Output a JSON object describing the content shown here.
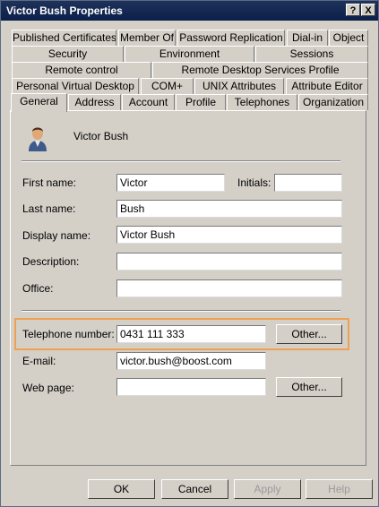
{
  "window": {
    "title": "Victor Bush Properties"
  },
  "titlebar_buttons": {
    "help": "?",
    "close": "X"
  },
  "tabs": {
    "row1": [
      "Published Certificates",
      "Member Of",
      "Password Replication",
      "Dial-in",
      "Object"
    ],
    "row2": [
      "Security",
      "Environment",
      "Sessions"
    ],
    "row3": [
      "Remote control",
      "Remote Desktop Services Profile"
    ],
    "row4": [
      "Personal Virtual Desktop",
      "COM+",
      "UNIX Attributes",
      "Attribute Editor"
    ],
    "row5": [
      "General",
      "Address",
      "Account",
      "Profile",
      "Telephones",
      "Organization"
    ],
    "active": "General"
  },
  "general": {
    "display": "Victor Bush",
    "first_name_label": "First name:",
    "first_name": "Victor",
    "initials_label": "Initials:",
    "initials": "",
    "last_name_label": "Last name:",
    "last_name": "Bush",
    "display_name_label": "Display name:",
    "display_name": "Victor Bush",
    "description_label": "Description:",
    "description": "",
    "office_label": "Office:",
    "office": "",
    "telephone_label": "Telephone number:",
    "telephone": "0431 111 333",
    "telephone_other": "Other...",
    "email_label": "E-mail:",
    "email": "victor.bush@boost.com",
    "webpage_label": "Web page:",
    "webpage": "",
    "webpage_other": "Other..."
  },
  "footer": {
    "ok": "OK",
    "cancel": "Cancel",
    "apply": "Apply",
    "help": "Help"
  }
}
